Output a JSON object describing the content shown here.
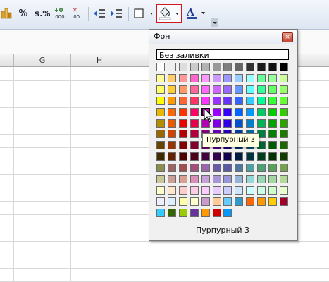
{
  "toolbar": {
    "percent_label": "%",
    "currency_label": "$.%",
    "add_decimal_label": "+0\n.000",
    "remove_decimal_label": ".00",
    "font_color_label": "A"
  },
  "columns": [
    "G",
    "H"
  ],
  "popup": {
    "title": "Фон",
    "no_fill_label": "Без заливки",
    "selected_name": "Пурпурный 3",
    "close_symbol": "×"
  },
  "tooltip_text": "Пурпурный 3",
  "palette": {
    "rows": [
      [
        "#ffffff",
        "#eeeeee",
        "#dddddd",
        "#cccccc",
        "#b2b2b2",
        "#999999",
        "#808080",
        "#666666",
        "#333333",
        "#1c1c1c",
        "#111111",
        "#000000"
      ],
      [
        "#ffff99",
        "#ffcc66",
        "#ff9999",
        "#ff66cc",
        "#ff99ff",
        "#cc99ff",
        "#9999ff",
        "#99ccff",
        "#99ffff",
        "#66ff99",
        "#99ff99",
        "#ccff99"
      ],
      [
        "#ffff66",
        "#ffcc33",
        "#ff9966",
        "#ff6699",
        "#ff66ff",
        "#cc66ff",
        "#9966ff",
        "#6699ff",
        "#66ffff",
        "#33ff99",
        "#66ff66",
        "#99ff66"
      ],
      [
        "#ffff00",
        "#ff9900",
        "#ff6633",
        "#ff3366",
        "#ff33ff",
        "#9933ff",
        "#6633ff",
        "#3366ff",
        "#33ccff",
        "#00ff99",
        "#33ff33",
        "#66ff33"
      ],
      [
        "#e6b800",
        "#ff6600",
        "#ff3300",
        "#ff0066",
        "#cc00cc",
        "#9900ff",
        "#3300ff",
        "#0066ff",
        "#0099ff",
        "#00cc66",
        "#00cc00",
        "#33cc00"
      ],
      [
        "#b38f00",
        "#e65c00",
        "#e60000",
        "#e6004c",
        "#b300b3",
        "#8000e6",
        "#2e00e6",
        "#0052cc",
        "#0080cc",
        "#00b359",
        "#00a300",
        "#2da300"
      ],
      [
        "#996600",
        "#cc4400",
        "#b30000",
        "#b3003c",
        "#800080",
        "#6600b3",
        "#2600b3",
        "#003d99",
        "#006699",
        "#008040",
        "#008000",
        "#1f7a00"
      ],
      [
        "#664400",
        "#993300",
        "#800000",
        "#80002b",
        "#660066",
        "#4d0080",
        "#1a0080",
        "#002966",
        "#004d66",
        "#006633",
        "#005c00",
        "#1a6600"
      ],
      [
        "#3d2900",
        "#662200",
        "#4d0000",
        "#4d001a",
        "#400040",
        "#33004d",
        "#10004d",
        "#001a40",
        "#003340",
        "#003d1f",
        "#003300",
        "#0f3d00"
      ],
      [
        "#8c8c50",
        "#996666",
        "#a05050",
        "#a0507a",
        "#9966aa",
        "#6a5aa0",
        "#5a5aa0",
        "#5077a0",
        "#50a0a0",
        "#50a077",
        "#5aa05a",
        "#77a050"
      ],
      [
        "#c8c896",
        "#c8a096",
        "#d8a090",
        "#d890b8",
        "#c8a0d8",
        "#a896d8",
        "#9696d8",
        "#96b4d8",
        "#96d8d8",
        "#96d8b4",
        "#a0d8a0",
        "#b4d896"
      ],
      [
        "#ffffcc",
        "#ffe6cc",
        "#ffcccc",
        "#ffcce6",
        "#ffccff",
        "#e6ccff",
        "#ccccff",
        "#cce6ff",
        "#ccffff",
        "#ccffe6",
        "#ccffcc",
        "#e6ffcc"
      ],
      [
        "#eeeeff",
        "#ddeeff",
        "#ffffaa",
        "#ffffcc",
        "#cc99cc",
        "#ffcc99",
        "#66ccff",
        "#3399cc",
        "#ff6600",
        "#ff9900",
        "#ffcc00",
        "#a0002c"
      ],
      [
        "#33ccff",
        "#336600",
        "#99cc00",
        "#663399",
        "#ff9900",
        "#cc0000",
        "#0099ff"
      ]
    ],
    "selected_row": 4,
    "selected_col": 4
  }
}
